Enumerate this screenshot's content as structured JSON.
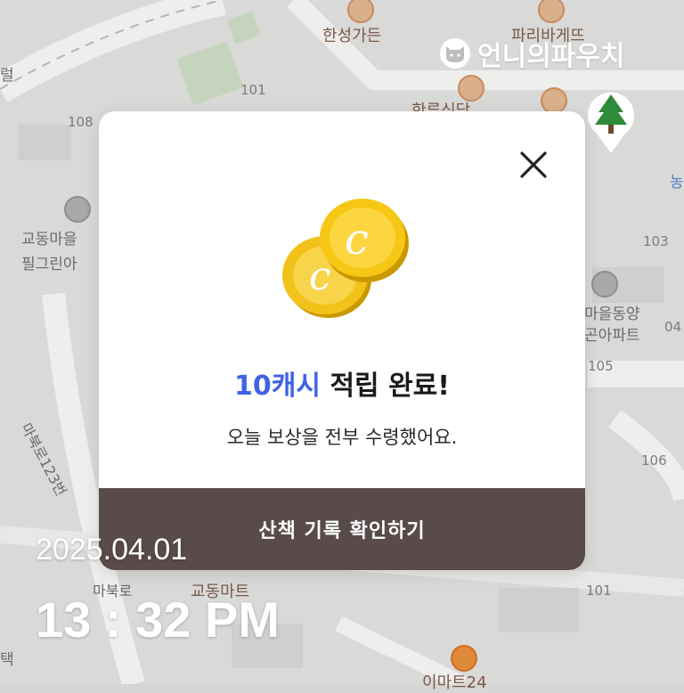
{
  "brand": {
    "name": "언니의파우치",
    "logo_icon": "cat-face-icon"
  },
  "map": {
    "labels": {
      "hansung_garden": "한성가든",
      "paris_baguette": "파리바게뜨",
      "restaurant": "한루식당",
      "apt_gyodong": "교동마을",
      "apt_pilgrim": "필그린아",
      "apt_maeul_top": "마을동양",
      "apt_maeul_bottom": "곤아파트",
      "road": "마북로123번",
      "mabuk": "마북로",
      "gyodong_mart": "교동마트",
      "emart24": "이마트24",
      "left_edge_top": "럴",
      "left_edge_bottom": "택",
      "right_edge": "농"
    },
    "numbers": {
      "n101_top": "101",
      "n108": "108",
      "n103": "103",
      "n104": "04",
      "n105": "105",
      "n106": "106",
      "n101_bottom": "101"
    },
    "colors": {
      "background": "#d6d6d4",
      "road": "#ececea",
      "park": "#c8d8c0"
    }
  },
  "modal": {
    "close_icon": "close-icon",
    "coin_icon": "coin-icon",
    "title_accent": "10캐시",
    "title_rest": "적립 완료!",
    "subtitle": "오늘 보상을 전부 수령했어요.",
    "cta_label": "산책 기록 확인하기",
    "colors": {
      "accent": "#3f63e6",
      "cta_bg": "#5a4b4b",
      "coin": "#f5c518"
    }
  },
  "overlay": {
    "date": "2025.04.01",
    "time": "13 : 32 PM"
  },
  "markers": {
    "tree_icon": "tree-icon",
    "tree_color": "#2e8b3a"
  }
}
